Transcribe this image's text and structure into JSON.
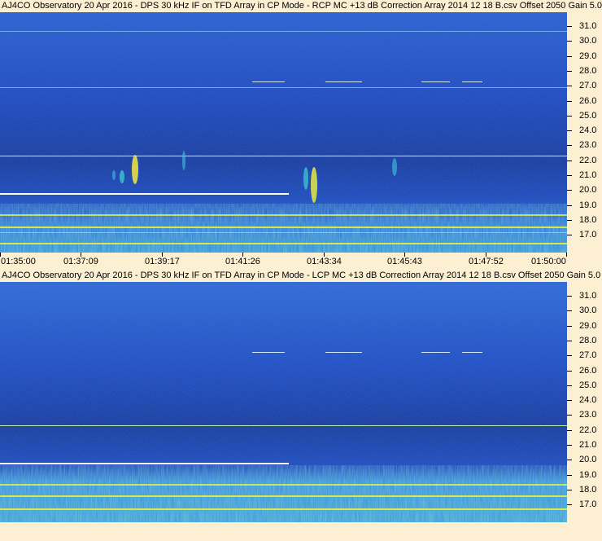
{
  "top": {
    "title": "AJ4CO Observatory 20 Apr 2016 - DPS 30 kHz IF on TFD Array in CP Mode - RCP  MC +13 dB  Correction Array 2014 12 18 B.csv  Offset 2050  Gain 5.0"
  },
  "bottom": {
    "title": "AJ4CO Observatory 20 Apr 2016 - DPS 30 kHz IF on TFD Array in CP Mode - LCP  MC +13 dB  Correction Array 2014 12 18 B.csv  Offset 2050  Gain 5.0"
  },
  "y_ticks": [
    "31.0",
    "30.0",
    "29.0",
    "28.0",
    "27.0",
    "26.0",
    "25.0",
    "24.0",
    "23.0",
    "22.0",
    "21.0",
    "20.0",
    "19.0",
    "18.0",
    "17.0"
  ],
  "x_ticks": [
    "01:35:00",
    "01:37:09",
    "01:39:17",
    "01:41:26",
    "01:43:34",
    "01:45:43",
    "01:47:52",
    "01:50:00"
  ],
  "colors": {
    "background": "#fdf0d2",
    "spectrogram_deep": "#0b2aa8",
    "spectrogram_mid": "#1e4fd0",
    "spectrogram_hot": "#f4ec3a"
  }
}
